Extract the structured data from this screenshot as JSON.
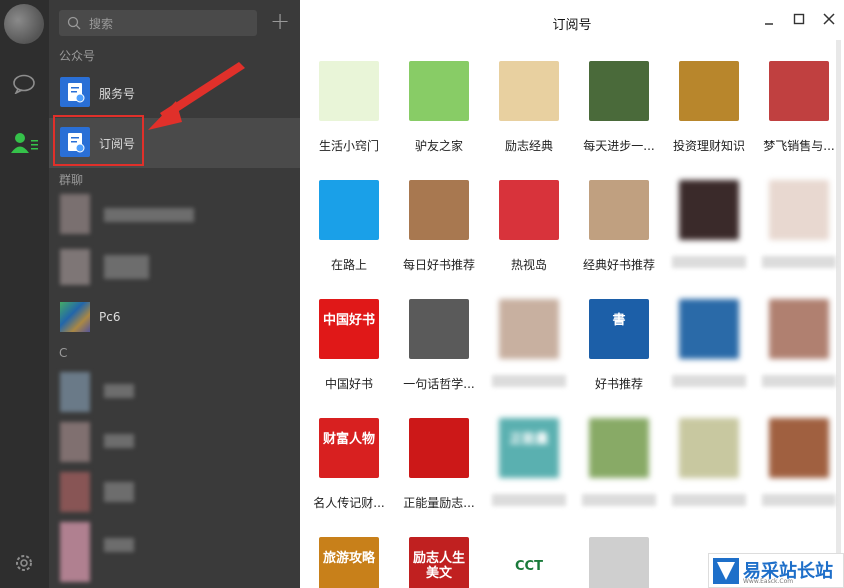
{
  "search": {
    "placeholder": "搜索"
  },
  "list": {
    "section_official": "公众号",
    "service_label": "服务号",
    "subscribe_label": "订阅号",
    "section_group": "群聊",
    "group_pc6": "Pc6",
    "section_c": "C"
  },
  "pane": {
    "title": "订阅号",
    "tiles": [
      "生活小窍门",
      "驴友之家",
      "励志经典",
      "每天进步一...",
      "投资理财知识",
      "梦飞销售与...",
      "在路上",
      "每日好书推荐",
      "热视岛",
      "经典好书推荐",
      "",
      "",
      "中国好书",
      "一句话哲学...",
      "",
      "好书推荐",
      "",
      "",
      "名人传记财...",
      "正能量励志...",
      "",
      "",
      "",
      "",
      "",
      "",
      "",
      "",
      "",
      ""
    ]
  },
  "tile_art": {
    "r4c0": "旅游攻略",
    "r4c1": "励志人生美文",
    "r4c2": "CCT",
    "r2c0": "中国好书",
    "r2c3": "書",
    "r3c0": "财富人物",
    "r3c2": "正能量"
  },
  "watermark": {
    "text": "易采站长站",
    "sub": "Www.Easck.Com"
  }
}
